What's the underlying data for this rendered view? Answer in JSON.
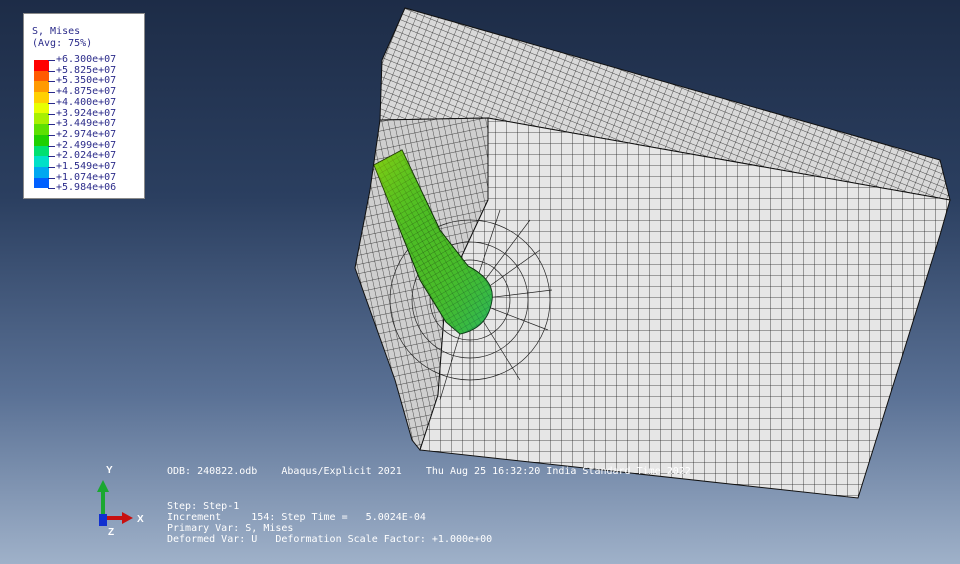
{
  "legend": {
    "title": "S, Mises",
    "subtitle": "(Avg: 75%)",
    "values": [
      "+6.300e+07",
      "+5.825e+07",
      "+5.350e+07",
      "+4.875e+07",
      "+4.400e+07",
      "+3.924e+07",
      "+3.449e+07",
      "+2.974e+07",
      "+2.499e+07",
      "+2.024e+07",
      "+1.549e+07",
      "+1.074e+07",
      "+5.984e+06"
    ],
    "colors": [
      "#ff0000",
      "#ff5a00",
      "#ff9a00",
      "#ffd000",
      "#e8ff00",
      "#a8f000",
      "#5ce000",
      "#1ed000",
      "#00e070",
      "#00e0c8",
      "#00a8f0",
      "#0060ff",
      "#0000e0"
    ]
  },
  "info": {
    "odb_line": "ODB: 240822.odb    Abaqus/Explicit 2021    Thu Aug 25 16:32:20 India Standard Time 2022",
    "step_line": "Step: Step-1",
    "increment_line": "Increment     154: Step Time =   5.0024E-04",
    "primary_var_line": "Primary Var: S, Mises",
    "deformed_var_line": "Deformed Var: U   Deformation Scale Factor: +1.000e+00"
  },
  "triad": {
    "x_label": "X",
    "y_label": "Y",
    "z_label": "Z"
  },
  "colors": {
    "mesh_face": "#e4e4e4",
    "mesh_line": "#1a1a1a",
    "hole_stress": "#46b82a"
  }
}
